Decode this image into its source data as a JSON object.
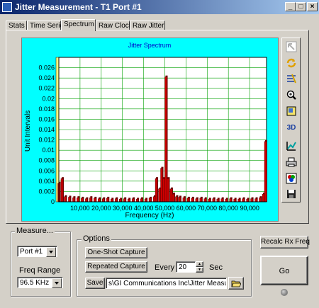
{
  "window": {
    "title": "Jitter Measurement - T1 Port #1",
    "minimize": "_",
    "maximize": "□",
    "close": "×"
  },
  "tabs": [
    {
      "label": "Stats"
    },
    {
      "label": "Time Series"
    },
    {
      "label": "Spectrum",
      "active": true
    },
    {
      "label": "Raw Clock"
    },
    {
      "label": "Raw Jitter"
    }
  ],
  "chart_data": {
    "type": "bar",
    "title": "Jitter Spectrum",
    "xlabel": "Frequency (Hz)",
    "ylabel": "Unit Intervals",
    "xlim": [
      0,
      98000
    ],
    "ylim": [
      0,
      0.028
    ],
    "xticks": [
      10000,
      20000,
      30000,
      40000,
      50000,
      60000,
      70000,
      80000,
      90000
    ],
    "xtick_labels": [
      "10,000",
      "20,000",
      "30,000",
      "40,000",
      "50,000",
      "60,000",
      "70,000",
      "80,000",
      "90,000"
    ],
    "yticks": [
      0,
      0.002,
      0.004,
      0.006,
      0.008,
      0.01,
      0.012,
      0.014,
      0.016,
      0.018,
      0.02,
      0.022,
      0.024,
      0.026
    ],
    "ytick_labels": [
      "0",
      "0.002",
      "0.004",
      "0.006",
      "0.008",
      "0.01",
      "0.012",
      "0.014",
      "0.016",
      "0.018",
      "0.02",
      "0.022",
      "0.024",
      "0.026"
    ],
    "grid": true,
    "bar_color": "#cc0000",
    "x": [
      0,
      1500,
      3000,
      5000,
      7000,
      9000,
      11000,
      13000,
      15000,
      17000,
      19000,
      21000,
      23000,
      25000,
      27000,
      29000,
      31000,
      33000,
      35000,
      37000,
      39000,
      41000,
      43000,
      45000,
      46000,
      47500,
      48500,
      49500,
      50500,
      51500,
      53000,
      54000,
      55500,
      57000,
      59000,
      61000,
      63000,
      65000,
      67000,
      69000,
      71000,
      73000,
      75000,
      77000,
      79000,
      81000,
      83000,
      85000,
      87000,
      89000,
      91000,
      93000,
      95000,
      96500,
      97500
    ],
    "values": [
      0.0036,
      0.0045,
      0.001,
      0.0009,
      0.0008,
      0.0008,
      0.0007,
      0.0006,
      0.0008,
      0.0007,
      0.0006,
      0.0006,
      0.0007,
      0.0005,
      0.0006,
      0.0005,
      0.0006,
      0.0005,
      0.0006,
      0.0005,
      0.0006,
      0.0005,
      0.0007,
      0.001,
      0.0045,
      0.0025,
      0.0065,
      0.0045,
      0.0242,
      0.0045,
      0.0025,
      0.0015,
      0.001,
      0.0009,
      0.0008,
      0.0007,
      0.0007,
      0.0006,
      0.0007,
      0.0006,
      0.0005,
      0.0006,
      0.0005,
      0.0006,
      0.0005,
      0.0006,
      0.0005,
      0.0005,
      0.0006,
      0.0005,
      0.0006,
      0.0006,
      0.0008,
      0.0015,
      0.0117
    ]
  },
  "toolbar": [
    {
      "icon": "pointer-arrow-icon"
    },
    {
      "icon": "refresh-icon"
    },
    {
      "icon": "axis-edit-icon"
    },
    {
      "icon": "zoom-icon"
    },
    {
      "icon": "gallery-icon"
    },
    {
      "icon": "three-d-icon",
      "label": "3D"
    },
    {
      "icon": "chart-type-icon"
    },
    {
      "icon": "print-icon"
    },
    {
      "icon": "palette-icon"
    },
    {
      "icon": "save-disk-icon"
    }
  ],
  "measure": {
    "label": "Measure...",
    "port": "Port #1",
    "freq_label": "Freq Range",
    "freq": "96.5 KHz"
  },
  "options": {
    "label": "Options",
    "one_shot": "One-Shot Capture",
    "repeated": "Repeated Capture",
    "every_label": "Every",
    "every_value": "20",
    "sec_label": "Sec",
    "save_label": "Save",
    "save_path": "s\\GI Communications Inc\\Jitter Measurement"
  },
  "actions": {
    "recalc": "Recalc Rx Freq",
    "go": "Go"
  }
}
